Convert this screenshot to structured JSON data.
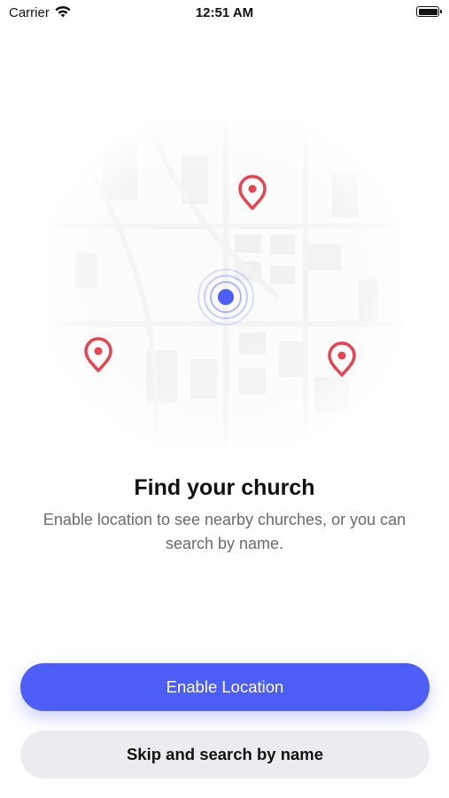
{
  "status_bar": {
    "carrier": "Carrier",
    "time": "12:51 AM"
  },
  "onboarding": {
    "title": "Find your church",
    "subtitle": "Enable location to see nearby churches, or you can search by name.",
    "primary_button": "Enable Location",
    "secondary_button": "Skip and search by name"
  },
  "colors": {
    "accent": "#4d5ef7",
    "pin": "#e8434f",
    "secondary_button_bg": "#ececf0",
    "subtitle_text": "#6b6b6b"
  },
  "icons": [
    "wifi-icon",
    "battery-icon",
    "map-pin-icon",
    "current-location-icon"
  ]
}
